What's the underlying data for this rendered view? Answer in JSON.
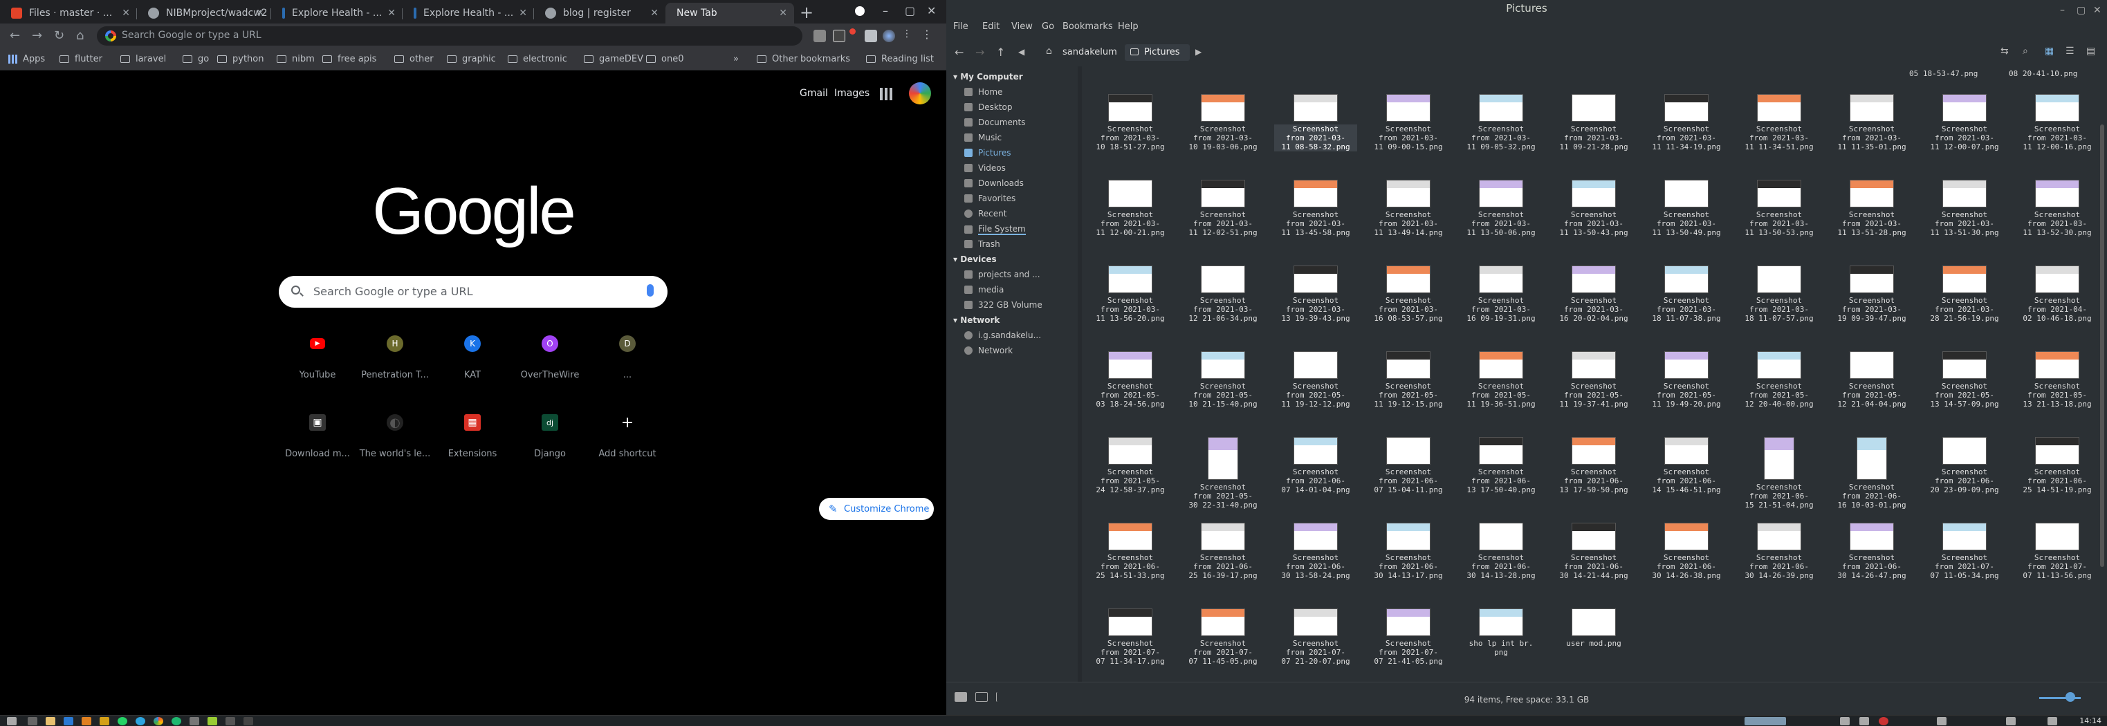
{
  "chrome": {
    "tabs": [
      {
        "title": "Files · master · ...",
        "color": "#e24329"
      },
      {
        "title": "NIBMproject/wadcw2",
        "color": "#9aa0a6"
      },
      {
        "title": "Explore Health - ...",
        "color": "#2b6cb0"
      },
      {
        "title": "Explore Health - ...",
        "color": "#2b6cb0"
      },
      {
        "title": "blog | register",
        "color": "#9aa0a6"
      },
      {
        "title": "New Tab",
        "color": "#000000"
      }
    ],
    "omnibox_placeholder": "Search Google or type a URL",
    "bookmarks": [
      "Apps",
      "flutter",
      "laravel",
      "go",
      "python",
      "nibm",
      "free apis",
      "other",
      "graphic",
      "electronic",
      "gameDEV",
      "one0"
    ],
    "bookmarks_overflow": "»",
    "other_bookmarks": "Other bookmarks",
    "reading_list": "Reading list",
    "newtab": {
      "gmail": "Gmail",
      "images": "Images",
      "logo": "Google",
      "search_placeholder": "Search Google or type a URL",
      "shortcuts": [
        {
          "label": "YouTube",
          "glyph": "▶",
          "color": "#ff0000"
        },
        {
          "label": "Penetration T...",
          "glyph": "H",
          "color": "#6b6a2c"
        },
        {
          "label": "KAT",
          "glyph": "K",
          "color": "#1a73e8"
        },
        {
          "label": "OverTheWire",
          "glyph": "O",
          "color": "#a142f4"
        },
        {
          "label": "...",
          "glyph": "D",
          "color": "#5a5a3a"
        },
        {
          "label": "Download m...",
          "glyph": "▣",
          "color": "#333333"
        },
        {
          "label": "The world's le...",
          "glyph": "◐",
          "color": "#222222"
        },
        {
          "label": "Extensions",
          "glyph": "▦",
          "color": "#d93025"
        },
        {
          "label": "Django",
          "glyph": "dj",
          "color": "#0c4b33"
        },
        {
          "label": "Add shortcut",
          "glyph": "+",
          "color": "#000000"
        }
      ],
      "customize": "Customize Chrome"
    }
  },
  "filemanager": {
    "title": "Pictures",
    "menu": [
      "File",
      "Edit",
      "View",
      "Go",
      "Bookmarks",
      "Help"
    ],
    "breadcrumb": [
      "sandakelum",
      "Pictures"
    ],
    "sidebar": {
      "my_computer": "My Computer",
      "places": [
        "Home",
        "Desktop",
        "Documents",
        "Music",
        "Pictures",
        "Videos",
        "Downloads",
        "Favorites",
        "Recent",
        "File System",
        "Trash"
      ],
      "devices_header": "Devices",
      "devices": [
        "projects and ...",
        "media",
        "322 GB Volume"
      ],
      "network_header": "Network",
      "network": [
        "i.g.sandakelu...",
        "Network"
      ]
    },
    "top_partial": [
      "05 18-53-47.png",
      "08 20-41-10.png"
    ],
    "files": [
      "Screenshot\nfrom 2021-03-\n10 18-51-27.png",
      "Screenshot\nfrom 2021-03-\n10 19-03-06.png",
      "Screenshot\nfrom 2021-03-\n11 08-58-32.png",
      "Screenshot\nfrom 2021-03-\n11 09-00-15.png",
      "Screenshot\nfrom 2021-03-\n11 09-05-32.png",
      "Screenshot\nfrom 2021-03-\n11 09-21-28.png",
      "Screenshot\nfrom 2021-03-\n11 11-34-19.png",
      "Screenshot\nfrom 2021-03-\n11 11-34-51.png",
      "Screenshot\nfrom 2021-03-\n11 11-35-01.png",
      "Screenshot\nfrom 2021-03-\n11 12-00-07.png",
      "Screenshot\nfrom 2021-03-\n11 12-00-16.png",
      "Screenshot\nfrom 2021-03-\n11 12-00-21.png",
      "Screenshot\nfrom 2021-03-\n11 12-02-51.png",
      "Screenshot\nfrom 2021-03-\n11 13-45-58.png",
      "Screenshot\nfrom 2021-03-\n11 13-49-14.png",
      "Screenshot\nfrom 2021-03-\n11 13-50-06.png",
      "Screenshot\nfrom 2021-03-\n11 13-50-43.png",
      "Screenshot\nfrom 2021-03-\n11 13-50-49.png",
      "Screenshot\nfrom 2021-03-\n11 13-50-53.png",
      "Screenshot\nfrom 2021-03-\n11 13-51-28.png",
      "Screenshot\nfrom 2021-03-\n11 13-51-30.png",
      "Screenshot\nfrom 2021-03-\n11 13-52-30.png",
      "Screenshot\nfrom 2021-03-\n11 13-56-20.png",
      "Screenshot\nfrom 2021-03-\n12 21-06-34.png",
      "Screenshot\nfrom 2021-03-\n13 19-39-43.png",
      "Screenshot\nfrom 2021-03-\n16 08-53-57.png",
      "Screenshot\nfrom 2021-03-\n16 09-19-31.png",
      "Screenshot\nfrom 2021-03-\n16 20-02-04.png",
      "Screenshot\nfrom 2021-03-\n18 11-07-38.png",
      "Screenshot\nfrom 2021-03-\n18 11-07-57.png",
      "Screenshot\nfrom 2021-03-\n19 09-39-47.png",
      "Screenshot\nfrom 2021-03-\n28 21-56-19.png",
      "Screenshot\nfrom 2021-04-\n02 10-46-18.png",
      "Screenshot\nfrom 2021-05-\n03 18-24-56.png",
      "Screenshot\nfrom 2021-05-\n10 21-15-40.png",
      "Screenshot\nfrom 2021-05-\n11 19-12-12.png",
      "Screenshot\nfrom 2021-05-\n11 19-12-15.png",
      "Screenshot\nfrom 2021-05-\n11 19-36-51.png",
      "Screenshot\nfrom 2021-05-\n11 19-37-41.png",
      "Screenshot\nfrom 2021-05-\n11 19-49-20.png",
      "Screenshot\nfrom 2021-05-\n12 20-40-00.png",
      "Screenshot\nfrom 2021-05-\n12 21-04-04.png",
      "Screenshot\nfrom 2021-05-\n13 14-57-09.png",
      "Screenshot\nfrom 2021-05-\n13 21-13-18.png",
      "Screenshot\nfrom 2021-05-\n24 12-58-37.png",
      "Screenshot\nfrom 2021-05-\n30 22-31-40.png",
      "Screenshot\nfrom 2021-06-\n07 14-01-04.png",
      "Screenshot\nfrom 2021-06-\n07 15-04-11.png",
      "Screenshot\nfrom 2021-06-\n13 17-50-40.png",
      "Screenshot\nfrom 2021-06-\n13 17-50-50.png",
      "Screenshot\nfrom 2021-06-\n14 15-46-51.png",
      "Screenshot\nfrom 2021-06-\n15 21-51-04.png",
      "Screenshot\nfrom 2021-06-\n16 10-03-01.png",
      "Screenshot\nfrom 2021-06-\n20 23-09-09.png",
      "Screenshot\nfrom 2021-06-\n25 14-51-19.png",
      "Screenshot\nfrom 2021-06-\n25 14-51-33.png",
      "Screenshot\nfrom 2021-06-\n25 16-39-17.png",
      "Screenshot\nfrom 2021-06-\n30 13-58-24.png",
      "Screenshot\nfrom 2021-06-\n30 14-13-17.png",
      "Screenshot\nfrom 2021-06-\n30 14-13-28.png",
      "Screenshot\nfrom 2021-06-\n30 14-21-44.png",
      "Screenshot\nfrom 2021-06-\n30 14-26-38.png",
      "Screenshot\nfrom 2021-06-\n30 14-26-39.png",
      "Screenshot\nfrom 2021-06-\n30 14-26-47.png",
      "Screenshot\nfrom 2021-07-\n07 11-05-34.png",
      "Screenshot\nfrom 2021-07-\n07 11-13-56.png",
      "Screenshot\nfrom 2021-07-\n07 11-34-17.png",
      "Screenshot\nfrom 2021-07-\n07 11-45-05.png",
      "Screenshot\nfrom 2021-07-\n07 21-20-07.png",
      "Screenshot\nfrom 2021-07-\n07 21-41-05.png",
      "sho lp int br.\npng",
      "user mod.png"
    ],
    "status": "94 items, Free space: 33.1 GB"
  },
  "taskbar": {
    "clock": "14:14"
  }
}
